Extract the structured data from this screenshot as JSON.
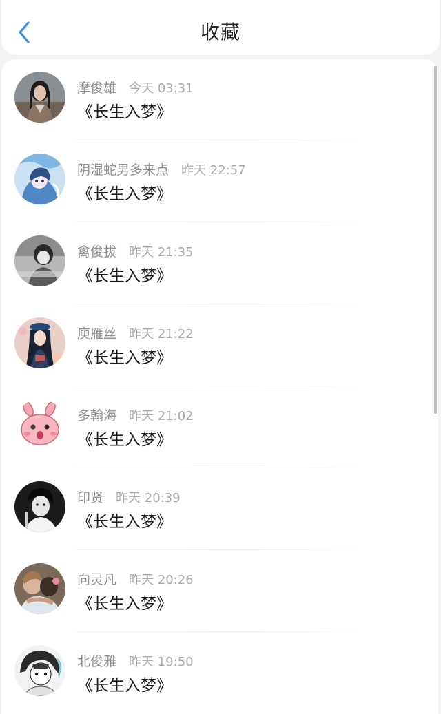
{
  "header": {
    "title": "收藏",
    "back_icon": "chevron-left-icon",
    "accent_color": "#3a8df0"
  },
  "favorites": [
    {
      "name": "摩俊雄",
      "time": "今天 03:31",
      "message": "《长生入梦》",
      "avatar_icon": "avatar-girl-braids-icon"
    },
    {
      "name": "阴湿蛇男多来点",
      "time": "昨天 22:57",
      "message": "《长生入梦》",
      "avatar_icon": "avatar-anime-blue-icon"
    },
    {
      "name": "禽俊拔",
      "time": "昨天 21:35",
      "message": "《长生入梦》",
      "avatar_icon": "avatar-gray-photo-icon"
    },
    {
      "name": "庾雁丝",
      "time": "昨天 21:22",
      "message": "《长生入梦》",
      "avatar_icon": "avatar-girl-beret-icon"
    },
    {
      "name": "多翰海",
      "time": "昨天 21:02",
      "message": "《长生入梦》",
      "avatar_icon": "avatar-pink-bunny-icon"
    },
    {
      "name": "印贤",
      "time": "昨天 20:39",
      "message": "《长生入梦》",
      "avatar_icon": "avatar-bw-boy-icon"
    },
    {
      "name": "向灵凡",
      "time": "昨天 20:26",
      "message": "《长生入梦》",
      "avatar_icon": "avatar-hug-photo-icon"
    },
    {
      "name": "北俊雅",
      "time": "昨天 19:50",
      "message": "《长生入梦》",
      "avatar_icon": "avatar-manga-sketch-icon"
    }
  ]
}
